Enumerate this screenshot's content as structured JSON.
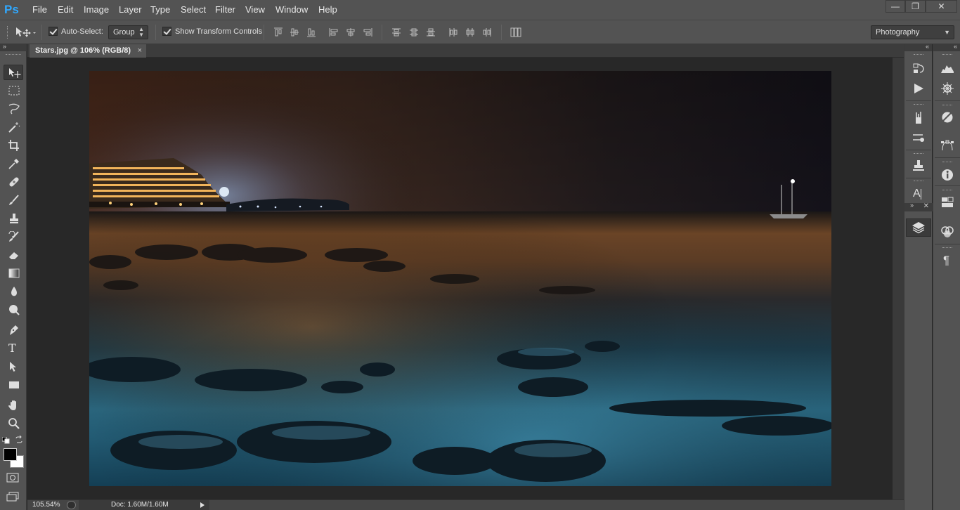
{
  "app": {
    "logo": "Ps",
    "name": "Adobe Photoshop"
  },
  "menu": [
    "File",
    "Edit",
    "Image",
    "Layer",
    "Type",
    "Select",
    "Filter",
    "View",
    "Window",
    "Help"
  ],
  "window_controls": {
    "minimize": "—",
    "restore": "❐",
    "close": "✕"
  },
  "options": {
    "auto_select_label": "Auto-Select:",
    "auto_select_checked": true,
    "auto_select_mode": "Group",
    "show_transform_label": "Show Transform Controls",
    "show_transform_checked": true,
    "workspace": "Photography"
  },
  "document": {
    "tab_title": "Stars.jpg @ 106% (RGB/8)",
    "tab_close": "×",
    "zoom": "105.54%",
    "doc_info": "Doc: 1.60M/1.60M"
  },
  "tools": [
    "move-tool",
    "marquee-tool",
    "lasso-tool",
    "magic-wand-tool",
    "crop-tool",
    "eyedropper-tool",
    "healing-brush-tool",
    "brush-tool",
    "clone-stamp-tool",
    "history-brush-tool",
    "eraser-tool",
    "gradient-tool",
    "blur-tool",
    "dodge-tool",
    "pen-tool",
    "type-tool",
    "path-selection-tool",
    "rectangle-tool",
    "hand-tool",
    "zoom-tool"
  ],
  "type_tool_glyph": "T",
  "colors": {
    "foreground": "#000000",
    "background": "#ffffff",
    "accent": "#30a8ff",
    "ui_bg": "#535353"
  },
  "panels_dock1": [
    "history-icon",
    "actions-icon",
    "brush-presets-icon",
    "tool-presets-icon",
    "clone-source-icon",
    "character-styles-icon",
    "layers-icon"
  ],
  "panels_dock2": [
    "histogram-icon",
    "navigator-icon",
    "adjustments-icon",
    "paths-icon",
    "info-icon",
    "properties-icon",
    "channels-icon",
    "paragraph-icon"
  ],
  "character_glyph": "A",
  "paragraph_glyph": "¶"
}
